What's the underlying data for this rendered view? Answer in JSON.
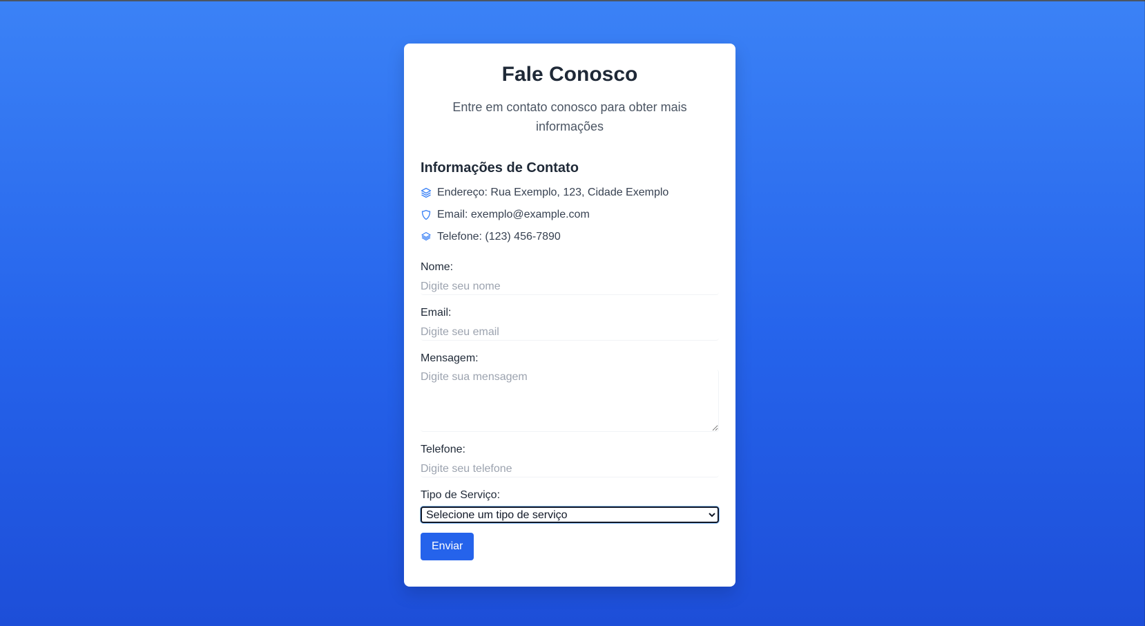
{
  "colors": {
    "background_top": "#3b82f6",
    "background_bottom": "#1d4ed8",
    "accent": "#2563eb",
    "card": "#ffffff",
    "heading": "#1f2937"
  },
  "header": {
    "title": "Fale Conosco",
    "subtitle": "Entre em contato conosco para obter mais informações"
  },
  "contact_info": {
    "title": "Informações de Contato",
    "items": [
      {
        "icon": "layers-icon",
        "text": "Endereço: Rua Exemplo, 123, Cidade Exemplo"
      },
      {
        "icon": "shield-icon",
        "text": "Email: exemplo@example.com"
      },
      {
        "icon": "layers-icon",
        "text": "Telefone: (123) 456-7890"
      }
    ]
  },
  "form": {
    "name": {
      "label": "Nome:",
      "placeholder": "Digite seu nome",
      "value": ""
    },
    "email": {
      "label": "Email:",
      "placeholder": "Digite seu email",
      "value": ""
    },
    "message": {
      "label": "Mensagem:",
      "placeholder": "Digite sua mensagem",
      "value": ""
    },
    "phone": {
      "label": "Telefone:",
      "placeholder": "Digite seu telefone",
      "value": ""
    },
    "service": {
      "label": "Tipo de Serviço:",
      "selected": "Selecione um tipo de serviço"
    },
    "submit_label": "Enviar"
  }
}
